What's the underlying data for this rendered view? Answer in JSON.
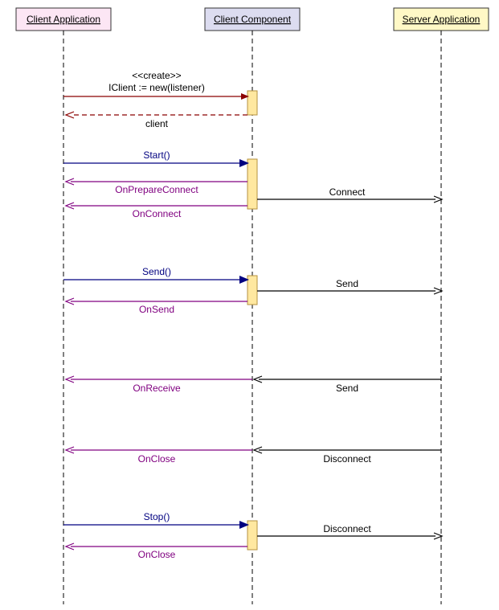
{
  "lifelines": {
    "client_app": {
      "label": "Client Application",
      "fill": "#fce6f4",
      "stroke": "#b05a9e"
    },
    "client_component": {
      "label": "Client Component",
      "fill": "#dcdcf0",
      "stroke": "#6a6aa0"
    },
    "server_app": {
      "label": "Server Application",
      "fill": "#fff8c6",
      "stroke": "#c9b23d"
    }
  },
  "messages": {
    "create_stereo": "<<create>>",
    "create_call": "IClient := new(listener)",
    "create_return": "client",
    "start": "Start()",
    "on_prepare": "OnPrepareConnect",
    "connect": "Connect",
    "on_connect": "OnConnect",
    "send_call": "Send()",
    "send_out": "Send",
    "on_send": "OnSend",
    "server_send": "Send",
    "on_receive": "OnReceive",
    "disconnect1": "Disconnect",
    "on_close1": "OnClose",
    "stop": "Stop()",
    "disconnect2": "Disconnect",
    "on_close2": "OnClose"
  },
  "colors": {
    "create_line": "#8b0000",
    "sync_call_line": "#000080",
    "sync_call_text": "#000080",
    "return_line": "#800080",
    "return_text": "#800080",
    "server_line": "#000000",
    "create_text": "#000000"
  }
}
